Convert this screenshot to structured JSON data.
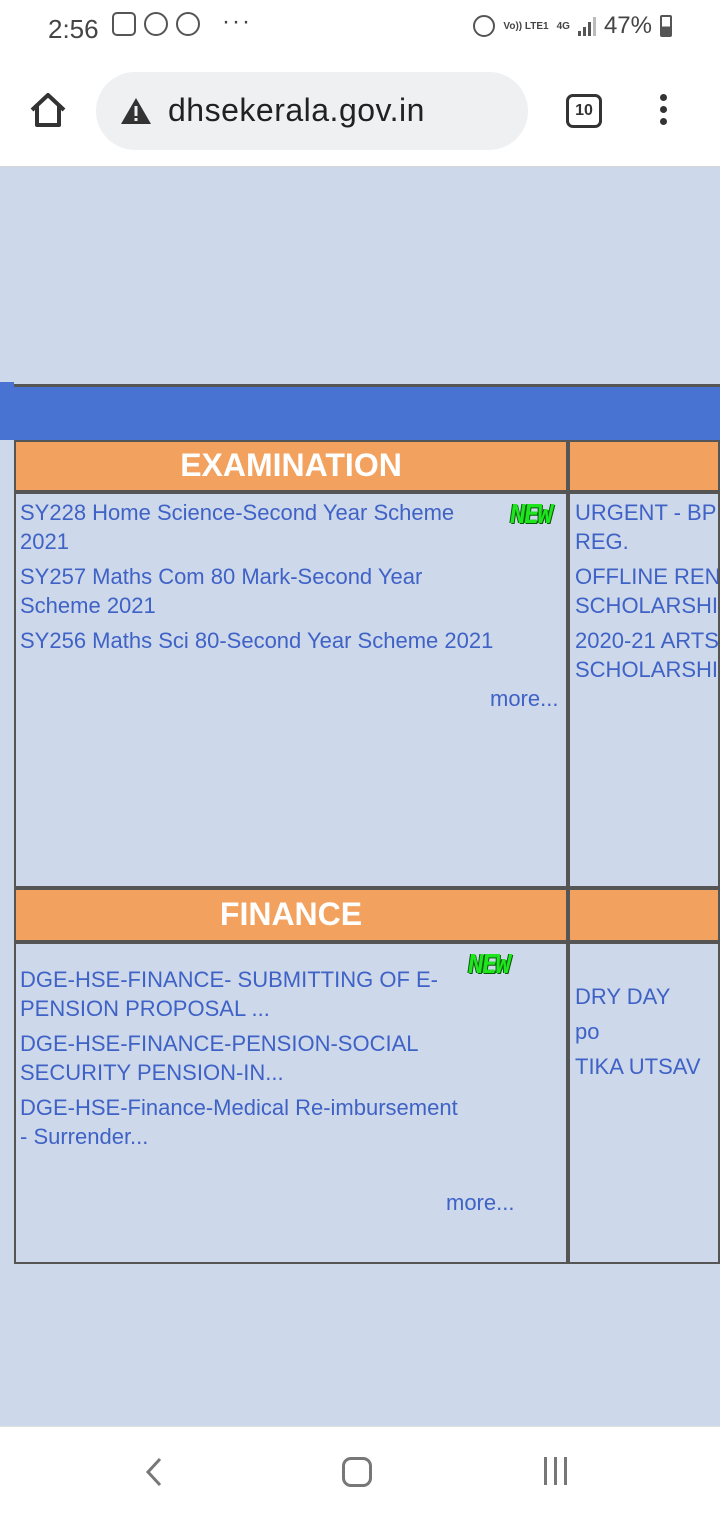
{
  "status_bar": {
    "time": "2:56",
    "dots": "···",
    "volte": "Vo)) LTE1",
    "network": "4G",
    "battery": "47%"
  },
  "browser": {
    "url": "dhsekerala.gov.in",
    "tab_count": "10"
  },
  "sections": {
    "examination": {
      "title": "EXAMINATION",
      "links": [
        "SY228 Home Science-Second Year Scheme 2021",
        "SY257 Maths Com 80 Mark-Second Year Scheme 2021",
        "SY256 Maths Sci 80-Second Year Scheme 2021"
      ],
      "new_badge": "NEW",
      "more": "more..."
    },
    "scholarship_column": {
      "links": [
        "URGENT - BP REG.",
        "OFFLINE REN SCHOLARSHI",
        "2020-21 ARTS SCHOLARSHI"
      ]
    },
    "finance": {
      "title": "FINANCE",
      "links": [
        "DGE-HSE-FINANCE- SUBMITTING OF E-PENSION PROPOSAL ...",
        "DGE-HSE-FINANCE-PENSION-SOCIAL SECURITY PENSION-IN...",
        "DGE-HSE-Finance-Medical Re-imbursement - Surrender..."
      ],
      "new_badge": "NEW",
      "more": "more..."
    },
    "events_column": {
      "links": [
        "DRY DAY",
        "po",
        "TIKA UTSAV"
      ]
    }
  },
  "colors": {
    "header_band": "#4873d2",
    "section_head": "#f2a25e",
    "page_bg": "#cdd8ea",
    "link": "#3f62c6"
  }
}
